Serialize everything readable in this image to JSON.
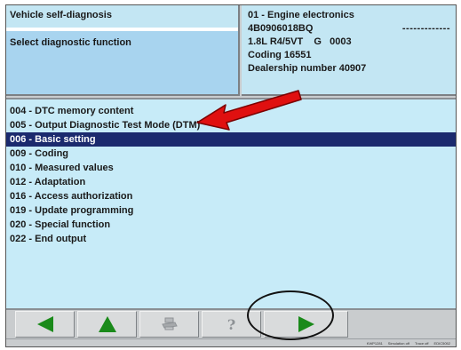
{
  "header": {
    "title": "Vehicle self-diagnosis",
    "function_prompt": "Select diagnostic function",
    "module": "01 - Engine electronics",
    "part_number": "4B0906018BQ",
    "part_number_suffix": "-------------",
    "engine": "1.8L R4/5VT    G   0003",
    "coding": "Coding 16551",
    "dealership": "Dealership number 40907"
  },
  "functions": [
    "004 - DTC memory content",
    "005 - Output Diagnostic Test Mode (DTM)",
    "006 - Basic setting",
    "009 - Coding",
    "010 - Measured values",
    "012 - Adaptation",
    "016 - Access authorization",
    "019 - Update programming",
    "020 - Special function",
    "022 - End output"
  ],
  "selected_index": 2,
  "toolbar": {
    "back_icon": "arrow-left-icon",
    "up_icon": "arrow-up-icon",
    "print_icon": "printer-icon",
    "help_icon": "help-icon",
    "help_glyph": "?",
    "next_icon": "arrow-right-icon"
  },
  "status": {
    "items": [
      "KWP1281",
      "Simulation off",
      "Trace off",
      "EDIC5052"
    ]
  },
  "colors": {
    "accent_green": "#1a8a1a",
    "selection": "#1b2a6e",
    "annotation_arrow": "#e01010"
  }
}
